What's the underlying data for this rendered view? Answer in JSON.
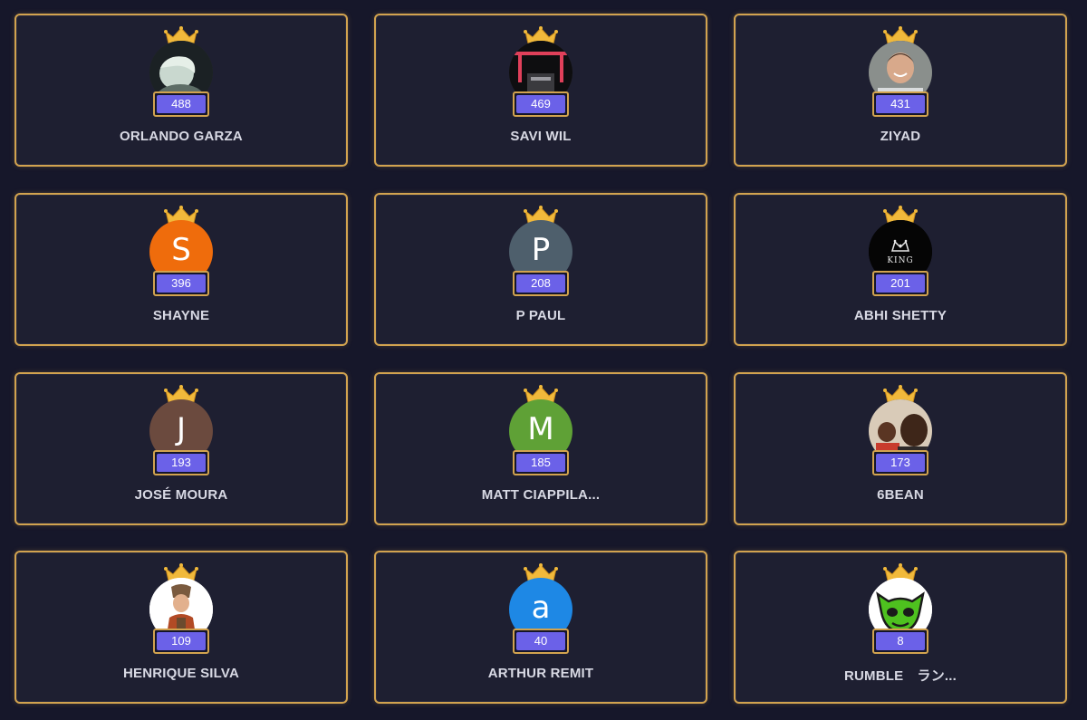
{
  "colors": {
    "background": "#16172a",
    "card": "#1e1f31",
    "gold_border": "#d2a34f",
    "score_badge": "#6b61e8",
    "name_text": "#d8d9e4"
  },
  "players": [
    {
      "name": "ORLANDO GARZA",
      "score": "488",
      "avatar": "photo-person-icon"
    },
    {
      "name": "SAVI WIL",
      "score": "469",
      "avatar": "photo-dark-scene-icon"
    },
    {
      "name": "ZIYAD",
      "score": "431",
      "avatar": "photo-person-icon"
    },
    {
      "name": "SHAYNE",
      "score": "396",
      "avatar_letter": "S",
      "avatar_color": "#ef6c0c"
    },
    {
      "name": "P PAUL",
      "score": "208",
      "avatar_letter": "P",
      "avatar_color": "#4e5f6c"
    },
    {
      "name": "ABHI SHETTY",
      "score": "201",
      "avatar": "king-logo-icon",
      "avatar_text": "KING"
    },
    {
      "name": "JOSÉ MOURA",
      "score": "193",
      "avatar_letter": "J",
      "avatar_color": "#6b4a3e"
    },
    {
      "name": "MATT CIAPPILA...",
      "score": "185",
      "avatar_letter": "M",
      "avatar_color": "#5fa136"
    },
    {
      "name": "6BEAN",
      "score": "173",
      "avatar": "photo-two-people-icon"
    },
    {
      "name": "HENRIQUE SILVA",
      "score": "109",
      "avatar": "game-character-icon"
    },
    {
      "name": "ARTHUR REMIT",
      "score": "40",
      "avatar_letter": "a",
      "avatar_color": "#1e88e5"
    },
    {
      "name": "RUMBLE　ラン...",
      "score": "8",
      "avatar": "green-monster-icon"
    }
  ]
}
